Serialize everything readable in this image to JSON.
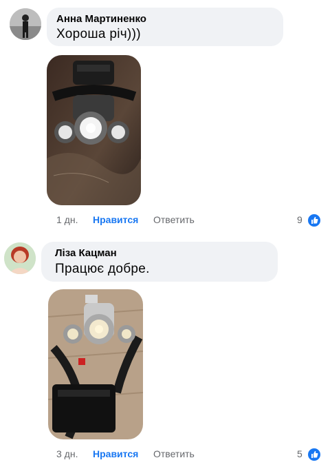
{
  "comments": [
    {
      "author": "Анна Мартиненко",
      "text": "Хороша річ)))",
      "photo_icon": "headlamp-photo",
      "time": "1 дн.",
      "like_label": "Нравится",
      "reply_label": "Ответить",
      "reactions": "9"
    },
    {
      "author": "Ліза Кацман",
      "text": "Працює добре.",
      "photo_icon": "headlamp-photo",
      "time": "3 дн.",
      "like_label": "Нравится",
      "reply_label": "Ответить",
      "reactions": "5"
    }
  ],
  "colors": {
    "accent": "#1877f2",
    "bubble": "#f0f2f5",
    "meta": "#65676b"
  }
}
